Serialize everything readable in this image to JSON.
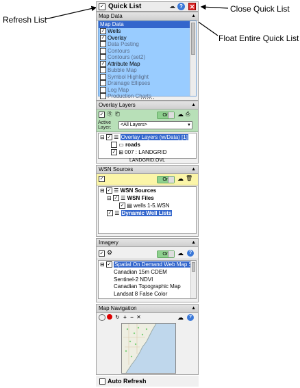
{
  "callouts": {
    "refresh_list": "Refresh List",
    "close_quick_list": "Close Quick List",
    "float_quick_list": "Float Entire Quick List"
  },
  "window": {
    "title": "Quick List"
  },
  "map_data": {
    "header": "Map Data",
    "root_label": "Map Data",
    "items": [
      {
        "label": "Wells",
        "checked": true
      },
      {
        "label": "Overlay",
        "checked": true
      },
      {
        "label": "Data Posting",
        "checked": false
      },
      {
        "label": "Contours",
        "checked": false
      },
      {
        "label": "Contours (set2)",
        "checked": false
      },
      {
        "label": "Attribute Map",
        "checked": true
      },
      {
        "label": "Bubble Map",
        "checked": false
      },
      {
        "label": "Symbol Highlight",
        "checked": false
      },
      {
        "label": "Drainage Ellipses",
        "checked": false
      },
      {
        "label": "Log Map",
        "checked": false
      },
      {
        "label": "Production Charts",
        "checked": false
      }
    ]
  },
  "overlay_layers": {
    "header": "Overlay Layers",
    "toggle_label": "On",
    "active_layer_label1": "Active",
    "active_layer_label2": "Layer:",
    "active_layer_value": "<All Layers>",
    "tree": {
      "root": "Overlay Layers (w/Data) [1]",
      "child1": "roads",
      "child2": "007 : LANDGRID"
    },
    "footer": "LANDGRID.OVL"
  },
  "wsn_sources": {
    "header": "WSN Sources",
    "toggle_label": "On",
    "tree": {
      "root": "WSN Sources",
      "child1": "WSN Files",
      "child2": "wells 1-5.WSN",
      "child3": "Dynamic Well Lists"
    }
  },
  "imagery": {
    "header": "Imagery",
    "toggle_label": "On",
    "tree": {
      "root": "Spatial On Demand Web Map Se",
      "items": [
        "Canadian 15m CDEM",
        "Sentinel-2 NDVI",
        "Canadian Topographic Map",
        "Landsat 8 False Color"
      ]
    }
  },
  "map_navigation": {
    "header": "Map Navigation"
  },
  "bottom": {
    "auto_refresh": "Auto Refresh"
  },
  "colors": {
    "selection": "#3366cc",
    "map_data_bg": "#99ccff",
    "on_green": "#8ed08e",
    "close_red": "#e03030",
    "help_blue": "#3a78d8"
  }
}
